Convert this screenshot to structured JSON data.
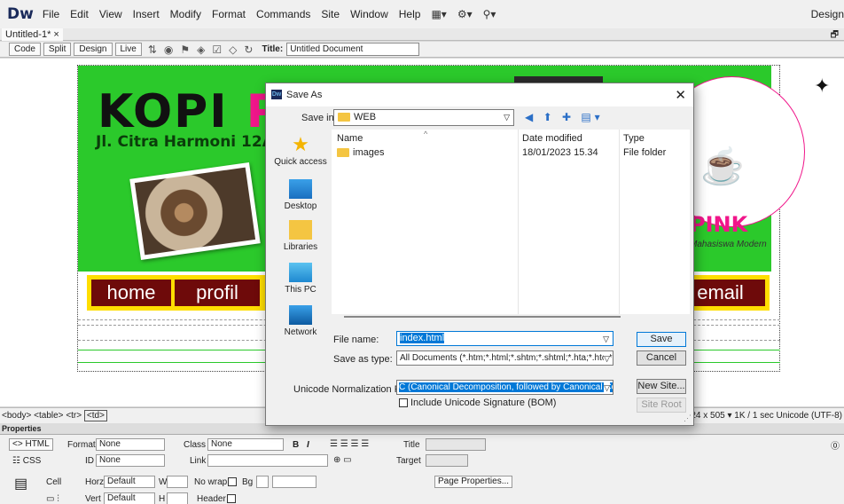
{
  "app": {
    "logo": "Dw",
    "menus": [
      "File",
      "Edit",
      "View",
      "Insert",
      "Modify",
      "Format",
      "Commands",
      "Site",
      "Window",
      "Help"
    ],
    "workspace": "Design"
  },
  "doc_tab": {
    "label": "Untitled-1*",
    "close": "×"
  },
  "toolbar": {
    "views": [
      "Code",
      "Split",
      "Design",
      "Live"
    ],
    "title_label": "Title:",
    "title_value": "Untitled Document"
  },
  "page": {
    "heading_black": "KOPI ",
    "heading_pink": "PI",
    "address": "Jl. Citra Harmoni 12A",
    "logo_text": "PINK",
    "logo_tagline": "Mahasiswa Modern",
    "nav": {
      "home": "home",
      "profil": "profil",
      "email": "email"
    }
  },
  "statusbar": {
    "tags": [
      "<body>",
      "<table>",
      "<tr>",
      "<td>"
    ],
    "dimensions": "1224 x 505",
    "download": "1K / 1 sec",
    "encoding": "Unicode (UTF-8)"
  },
  "properties": {
    "title": "Properties",
    "html_btn": "HTML",
    "css_btn": "CSS",
    "format_label": "Format",
    "format_value": "None",
    "id_label": "ID",
    "id_value": "None",
    "class_label": "Class",
    "class_value": "None",
    "link_label": "Link",
    "title_label": "Title",
    "target_label": "Target",
    "cell_label": "Cell",
    "horz_label": "Horz",
    "horz_value": "Default",
    "vert_label": "Vert",
    "vert_value": "Default",
    "w_label": "W",
    "h_label": "H",
    "nowrap_label": "No wrap",
    "header_label": "Header",
    "bg_label": "Bg",
    "page_props": "Page Properties..."
  },
  "dialog": {
    "title": "Save As",
    "save_in_label": "Save in:",
    "save_in_value": "WEB",
    "places": [
      "Quick access",
      "Desktop",
      "Libraries",
      "This PC",
      "Network"
    ],
    "columns": {
      "name": "Name",
      "date": "Date modified",
      "type": "Type"
    },
    "files": [
      {
        "name": "images",
        "date": "18/01/2023 15.34",
        "type": "File folder"
      }
    ],
    "file_name_label": "File name:",
    "file_name_value": "index.html",
    "save_as_type_label": "Save as type:",
    "save_as_type_value": "All Documents (*.htm;*.html;*.shtm;*.shtml;*.hta;*.htc;*.xhtml;*.",
    "save_btn": "Save",
    "cancel_btn": "Cancel",
    "unicode_label": "Unicode Normalization Form:",
    "unicode_value": "C (Canonical Decomposition, followed by Canonical Compos",
    "bom_label": "Include Unicode Signature (BOM)",
    "new_site_btn": "New Site...",
    "site_root_btn": "Site Root"
  },
  "colors": {
    "banner_green": "#2bc92b",
    "brand_pink": "#f0168a",
    "nav_maroon": "#6e0a0a",
    "nav_border": "#ffde00",
    "selection_blue": "#0078d7"
  }
}
